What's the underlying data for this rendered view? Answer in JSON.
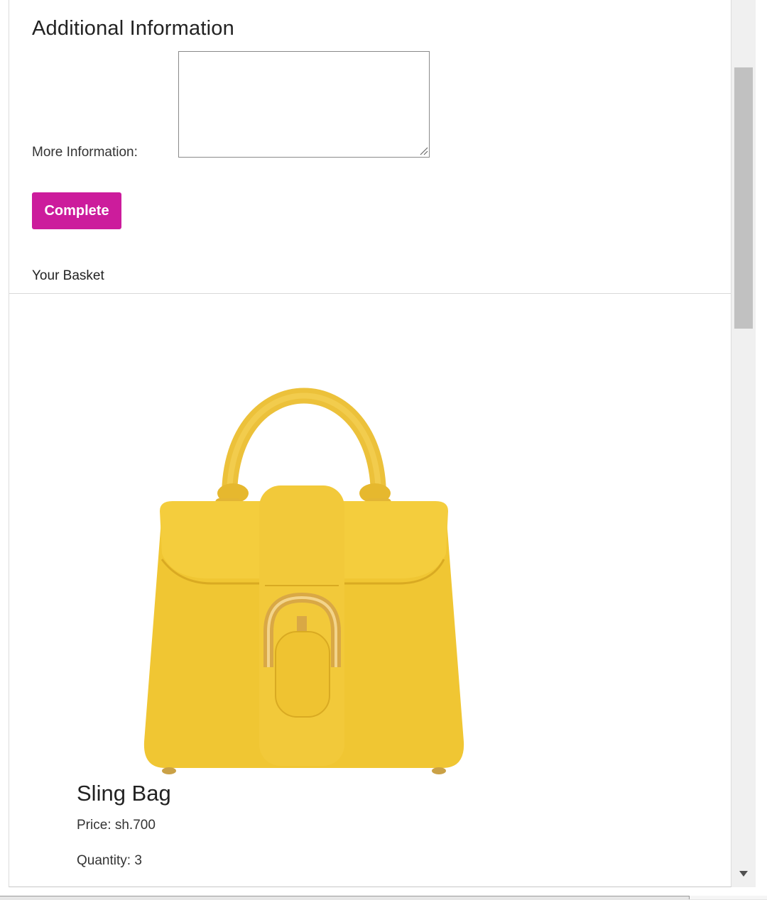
{
  "additional_info": {
    "title": "Additional Information",
    "more_info_label": "More Information:",
    "more_info_value": "",
    "complete_label": "Complete"
  },
  "basket": {
    "label": "Your Basket",
    "items": [
      {
        "name": "Sling Bag",
        "price": "Price: sh.700",
        "quantity": "Quantity: 3",
        "image_icon": "yellow-handbag"
      }
    ]
  },
  "colors": {
    "accent": "#cc1c9c",
    "bag": "#f0c633",
    "buckle": "#d9a845"
  }
}
